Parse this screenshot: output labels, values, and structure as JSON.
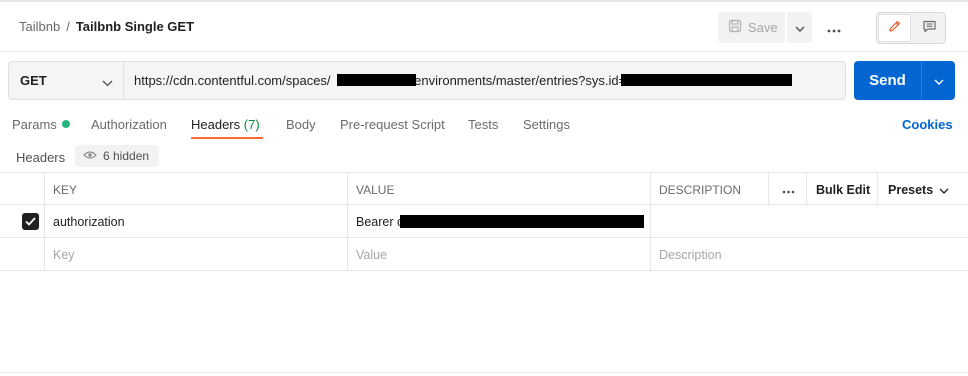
{
  "breadcrumb": {
    "parent": "Tailbnb",
    "separator": "/",
    "current": "Tailbnb Single GET"
  },
  "toolbar": {
    "save_label": "Save",
    "save_icon": "save-icon",
    "more_icon": "more-horizontal-icon",
    "edit_icon": "pencil-icon",
    "comment_icon": "comment-icon"
  },
  "request": {
    "method": "GET",
    "url_prefix": "https://cdn.contentful.com/spaces/",
    "url_middle": "/environments/master/entries?sys.id=",
    "send_label": "Send"
  },
  "tabs": [
    {
      "label": "Params",
      "has_indicator": true
    },
    {
      "label": "Authorization"
    },
    {
      "label": "Headers",
      "count": "(7)",
      "active": true
    },
    {
      "label": "Body"
    },
    {
      "label": "Pre-request Script"
    },
    {
      "label": "Tests"
    },
    {
      "label": "Settings"
    }
  ],
  "cookies_label": "Cookies",
  "headers_section": {
    "title": "Headers",
    "hidden_label": "6 hidden",
    "hidden_icon": "eye-icon"
  },
  "table": {
    "columns": {
      "key": "KEY",
      "value": "VALUE",
      "description": "DESCRIPTION",
      "more_icon": "more-horizontal-icon",
      "bulk_edit": "Bulk Edit",
      "presets": "Presets"
    },
    "rows": [
      {
        "checked": true,
        "key": "authorization",
        "value": "Bearer c",
        "description": ""
      }
    ],
    "placeholder": {
      "key": "Key",
      "value": "Value",
      "description": "Description"
    }
  },
  "colors": {
    "accent_orange": "#ff6c37",
    "send_blue": "#0265d2",
    "cookies_blue": "#0265d2",
    "count_green": "#0a8a3b",
    "params_dot": "#26b47f"
  }
}
